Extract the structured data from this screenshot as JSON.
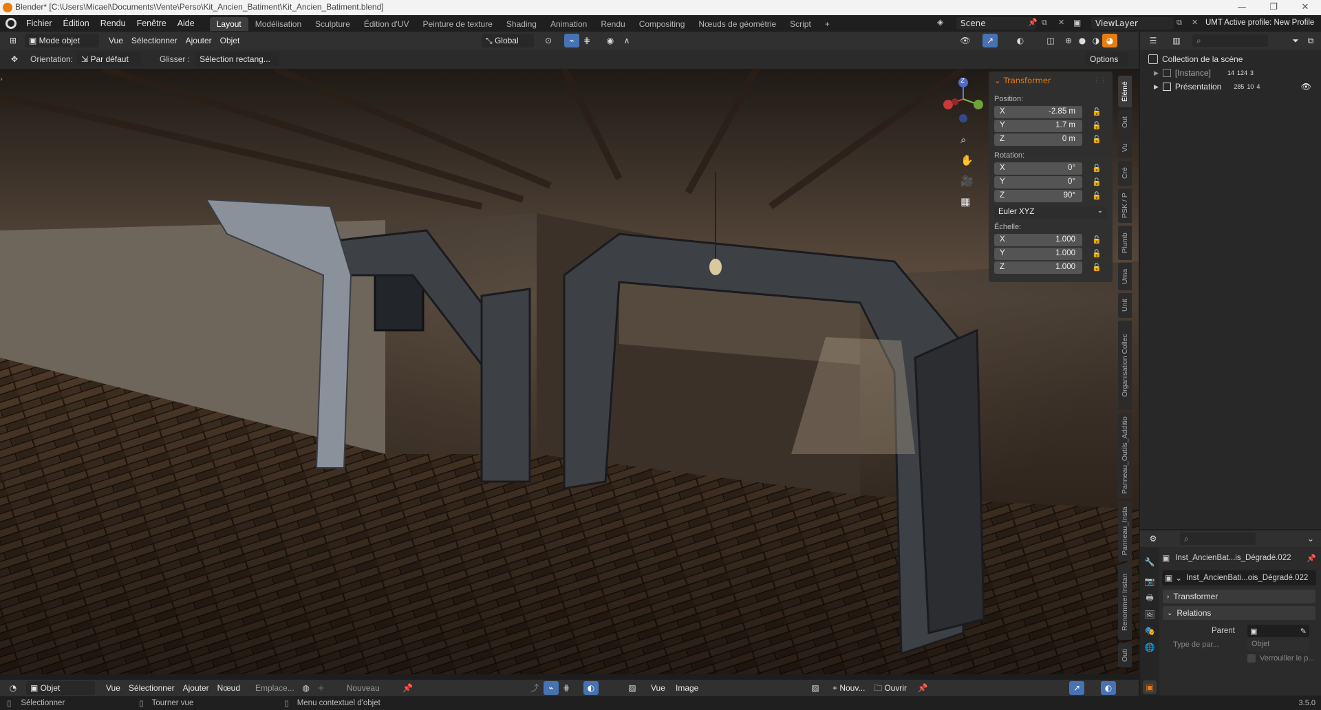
{
  "window": {
    "title": "Blender* [C:\\Users\\Micael\\Documents\\Vente\\Perso\\Kit_Ancien_Batiment\\Kit_Ancien_Batiment.blend]",
    "controls": [
      "—",
      "❐",
      "✕"
    ]
  },
  "topbar": {
    "menus": [
      "Fichier",
      "Édition",
      "Rendu",
      "Fenêtre",
      "Aide"
    ],
    "workspaces": [
      "Layout",
      "Modélisation",
      "Sculpture",
      "Édition d'UV",
      "Peinture de texture",
      "Shading",
      "Animation",
      "Rendu",
      "Compositing",
      "Nœuds de géométrie",
      "Script"
    ],
    "active_workspace": "Layout",
    "add_workspace": "+",
    "scene": "Scene",
    "view_layer": "ViewLayer",
    "profile": "UMT Active profile: New Profile"
  },
  "viewport_header": {
    "mode": "Mode objet",
    "menus": [
      "Vue",
      "Sélectionner",
      "Ajouter",
      "Objet"
    ],
    "orientation_global": "Global"
  },
  "tool_header": {
    "orientation_label": "Orientation:",
    "orientation_value": "Par défaut",
    "drag_label": "Glisser :",
    "drag_value": "Sélection rectang...",
    "options": "Options"
  },
  "npanel": {
    "section": "Transformer",
    "position_label": "Position:",
    "position": [
      {
        "axis": "X",
        "value": "-2.85 m"
      },
      {
        "axis": "Y",
        "value": "1.7 m"
      },
      {
        "axis": "Z",
        "value": "0 m"
      }
    ],
    "rotation_label": "Rotation:",
    "rotation": [
      {
        "axis": "X",
        "value": "0°"
      },
      {
        "axis": "Y",
        "value": "0°"
      },
      {
        "axis": "Z",
        "value": "90°"
      }
    ],
    "rotation_mode": "Euler XYZ",
    "scale_label": "Échelle:",
    "scale": [
      {
        "axis": "X",
        "value": "1.000"
      },
      {
        "axis": "Y",
        "value": "1.000"
      },
      {
        "axis": "Z",
        "value": "1.000"
      }
    ]
  },
  "sidebar_tabs": [
    "Élémé",
    "Out",
    "Vu",
    "Cré",
    "PSK / P",
    "Plumb",
    "Uma",
    "Unit",
    "Organisation Collec",
    "Panneau_Outils_Additio",
    "Panneau_Insta",
    "Renommer Instan",
    "Outi"
  ],
  "gizmo": {
    "z": "Z"
  },
  "outliner": {
    "collection": "Collection de la scène",
    "items": [
      {
        "name": "[Instance]",
        "counts": [
          "14",
          "124",
          "3"
        ]
      },
      {
        "name": "Présentation",
        "counts": [
          "285",
          "10",
          "4"
        ]
      }
    ]
  },
  "properties": {
    "object_name": "Inst_AncienBat...is_Dégradé.022",
    "data_name": "Inst_AncienBati...ois_Dégradé.022",
    "sections": [
      "Transformer",
      "Relations"
    ],
    "parent_label": "Parent",
    "parent_type_label": "Type de par...",
    "parent_type_value": "Objet",
    "lock_label": "Verrouiller le p..."
  },
  "bottom_header": {
    "mode": "Objet",
    "menus": [
      "Vue",
      "Sélectionner",
      "Ajouter",
      "Nœud"
    ],
    "slot": "Emplace...",
    "new": "Nouveau",
    "image_menus": [
      "Vue",
      "Image"
    ],
    "new_image": "Nouv...",
    "open": "Ouvrir"
  },
  "statusbar": {
    "select": "Sélectionner",
    "rotate": "Tourner vue",
    "context": "Menu contextuel d'objet",
    "version": "3.5.0"
  }
}
